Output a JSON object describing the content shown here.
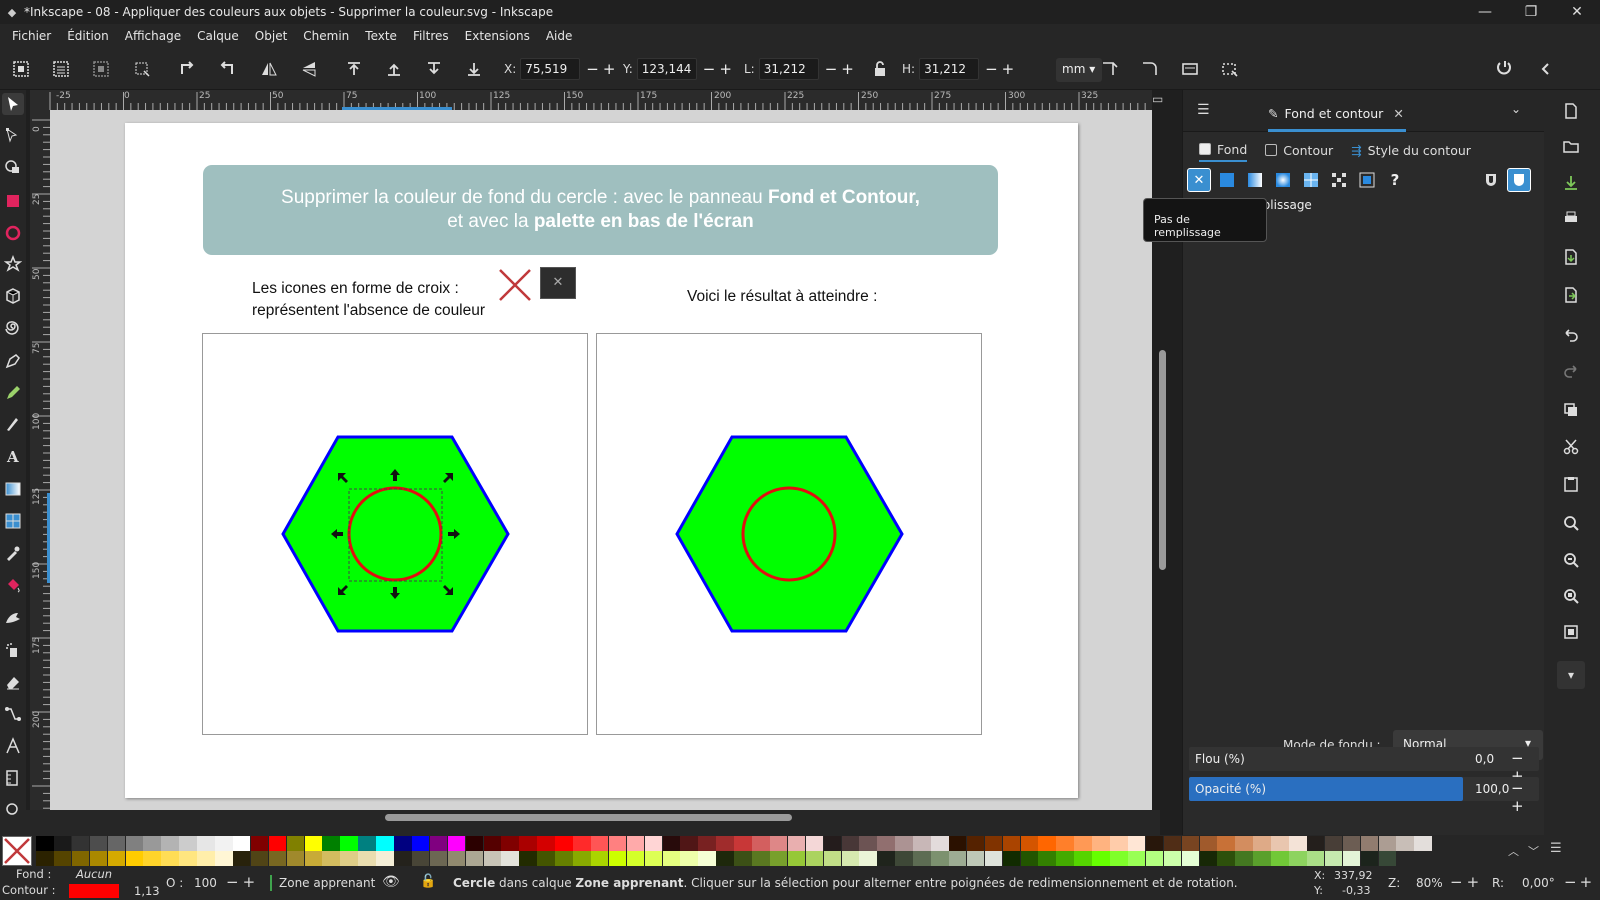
{
  "window": {
    "title": "*Inkscape - 08 - Appliquer des couleurs aux objets - Supprimer la couleur.svg - Inkscape"
  },
  "menu": [
    "Fichier",
    "Édition",
    "Affichage",
    "Calque",
    "Objet",
    "Chemin",
    "Texte",
    "Filtres",
    "Extensions",
    "Aide"
  ],
  "controls": {
    "x_label": "X:",
    "x_value": "75,519",
    "y_label": "Y:",
    "y_value": "123,144",
    "w_label": "L:",
    "w_value": "31,212",
    "h_label": "H:",
    "h_value": "31,212",
    "unit": "mm"
  },
  "ruler": {
    "h_labels": [
      "-25",
      "0",
      "25",
      "50",
      "75",
      "100",
      "125",
      "150",
      "175",
      "200",
      "225",
      "250",
      "275",
      "300",
      "325"
    ],
    "v_labels": [
      "0",
      "25",
      "50",
      "75",
      "100",
      "125",
      "150",
      "175",
      "200"
    ]
  },
  "document": {
    "banner_line1_a": "Supprimer la couleur de fond du cercle : avec le panneau ",
    "banner_line1_b": "Fond et Contour,",
    "banner_line2_a": "et avec la ",
    "banner_line2_b": "palette en bas de l'écran",
    "icons_text_line1": "Les icones en forme de croix :",
    "icons_text_line2": "représentent l'absence de couleur",
    "result_text": "Voici le résultat à atteindre :",
    "colors": {
      "fill": "#00ff00",
      "stroke": "#0000ff",
      "circle_stroke": "#e01010",
      "banner": "#9fbfbf"
    }
  },
  "dock": {
    "tab_title": "Fond et contour",
    "subtabs": [
      "Fond",
      "Contour",
      "Style du contour"
    ],
    "nofill_label": "Pas de remplissage",
    "tooltip": "Pas de remplissage",
    "blend_label": "Mode de fondu :",
    "blend_value": "Normal",
    "blur_label": "Flou (%)",
    "blur_value": "0,0",
    "opacity_label": "Opacité (%)",
    "opacity_value": "100,0",
    "opacity_fraction": 1.0
  },
  "status": {
    "fill_label": "Fond :",
    "fill_value": "Aucun",
    "stroke_label": "Contour :",
    "stroke_color": "#ff0000",
    "stroke_width": "1,13",
    "opacity_label": "O :",
    "opacity_value": "100",
    "layer": "Zone apprenant",
    "message_a": "Cercle",
    "message_b": " dans calque ",
    "message_c": "Zone apprenant",
    "message_d": ". Cliquer sur la sélection pour alterner entre poignées de redimensionnement et de rotation.",
    "cursor_x_label": "X:",
    "cursor_x": "337,92",
    "cursor_y_label": "Y:",
    "cursor_y": "-0,33",
    "zoom_label": "Z:",
    "zoom": "80%",
    "rotation_label": "R:",
    "rotation": "0,00°"
  },
  "palette_row1": [
    "#000000",
    "#1a1a1a",
    "#333333",
    "#4d4d4d",
    "#666666",
    "#808080",
    "#999999",
    "#b3b3b3",
    "#cccccc",
    "#e6e6e6",
    "#f2f2f2",
    "#ffffff",
    "#800000",
    "#ff0000",
    "#808000",
    "#ffff00",
    "#008000",
    "#00ff00",
    "#008080",
    "#00ffff",
    "#000080",
    "#0000ff",
    "#800080",
    "#ff00ff",
    "#2b0000",
    "#550000",
    "#800000",
    "#aa0000",
    "#d40000",
    "#ff0000",
    "#ff2a2a",
    "#ff5555",
    "#ff8080",
    "#ffaaaa",
    "#ffd5d5",
    "#280b0b",
    "#501616",
    "#782121",
    "#a02c2c",
    "#c83737",
    "#d35f5f",
    "#de8787",
    "#e9afaf",
    "#f4d7d7",
    "#241c1c",
    "#483737",
    "#6c5353",
    "#916f6f",
    "#ac9393",
    "#c8b7b7",
    "#e3dbdb",
    "#2b1100",
    "#552200",
    "#803300",
    "#aa4400",
    "#d45500",
    "#ff6600",
    "#ff7f2a",
    "#ff9955",
    "#ffb380",
    "#ffccaa",
    "#ffe6d5",
    "#28170b",
    "#502d16",
    "#784421",
    "#a05a2c",
    "#c87137",
    "#d38d5f",
    "#deaa87",
    "#e9c6af",
    "#f4e3d7",
    "#241f1c",
    "#483e37",
    "#6c5d53",
    "#917c6f",
    "#ac9d93",
    "#c8beb7",
    "#e3dedb"
  ],
  "palette_row2": [
    "#2b2200",
    "#554400",
    "#806600",
    "#aa8800",
    "#d4aa00",
    "#ffcc00",
    "#ffd42a",
    "#ffdd55",
    "#ffe680",
    "#ffeeaa",
    "#fff6d5",
    "#28220b",
    "#504416",
    "#786721",
    "#a0892c",
    "#c8ab37",
    "#d3bc5f",
    "#decd87",
    "#e9ddaf",
    "#f4eed7",
    "#24221c",
    "#484537",
    "#6c6753",
    "#918a6f",
    "#aca793",
    "#c8c4b7",
    "#e3e2db",
    "#222b00",
    "#445500",
    "#668000",
    "#88aa00",
    "#aad400",
    "#ccff00",
    "#d4ff2a",
    "#ddff55",
    "#e5ff80",
    "#eeffaa",
    "#f6ffd5",
    "#1e280b",
    "#3c5016",
    "#5a7821",
    "#78a02c",
    "#96c837",
    "#abd35f",
    "#c1de87",
    "#d6e9af",
    "#ebf4d7",
    "#1f241c",
    "#3e4837",
    "#5d6c53",
    "#7c916f",
    "#9dac93",
    "#bec8b7",
    "#dee3db",
    "#112b00",
    "#225500",
    "#338000",
    "#44aa00",
    "#55d400",
    "#66ff00",
    "#7fff2a",
    "#99ff55",
    "#b3ff80",
    "#ccffaa",
    "#e5ffd5",
    "#172806",
    "#2d500b",
    "#447821",
    "#5aa02c",
    "#71c837",
    "#8dd35f",
    "#aade87",
    "#c6e9af",
    "#e3f4d7",
    "#1c241c",
    "#374837"
  ]
}
